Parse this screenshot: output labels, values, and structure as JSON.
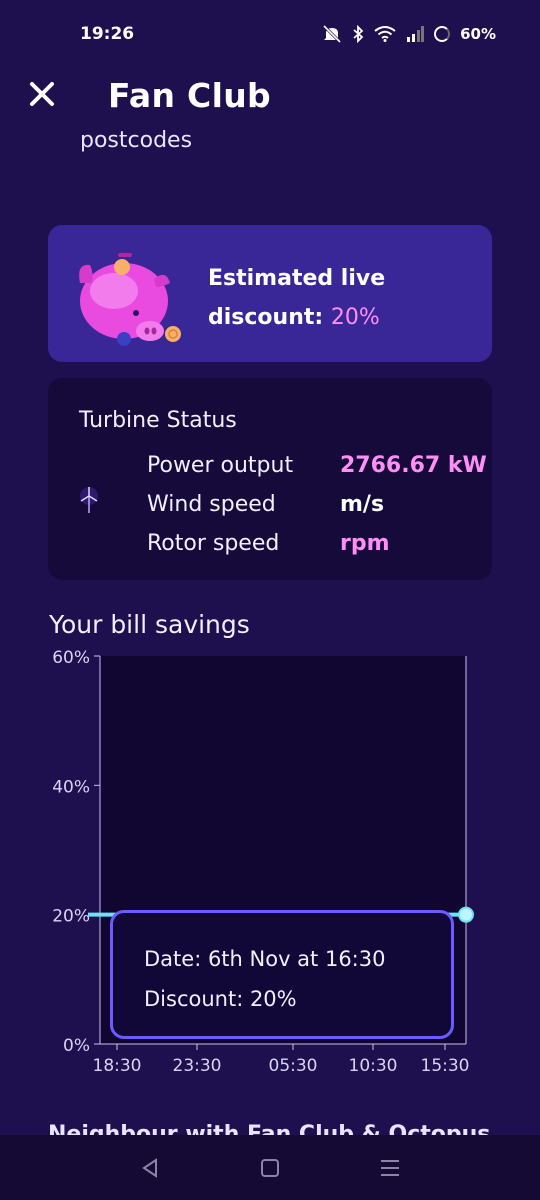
{
  "status_bar": {
    "time": "19:26",
    "battery_percent": "60%"
  },
  "header": {
    "title": "Fan Club",
    "close_icon": "close-icon"
  },
  "partial_text": "postcodes",
  "discount_card": {
    "label_line1": "Estimated live",
    "label_line2": "discount:",
    "value": "20%"
  },
  "turbine": {
    "title": "Turbine Status",
    "rows": [
      {
        "label": "Power output",
        "value": "2766.67 kW"
      },
      {
        "label": "Wind speed",
        "value": "m/s"
      },
      {
        "label": "Rotor speed",
        "value": "rpm"
      }
    ]
  },
  "savings": {
    "title": "Your bill savings",
    "tooltip": {
      "date_line": "Date: 6th Nov at 16:30",
      "discount_line": "Discount: 20%"
    }
  },
  "chart_data": {
    "type": "line",
    "x": [
      "18:30",
      "23:30",
      "05:30",
      "10:30",
      "15:30",
      "16:30"
    ],
    "x_ticks": [
      "18:30",
      "23:30",
      "05:30",
      "10:30",
      "15:30"
    ],
    "y_ticks": [
      "60%",
      "40%",
      "20%",
      "0%"
    ],
    "ylim": [
      0,
      60
    ],
    "series": [
      {
        "values": [
          20,
          20,
          20,
          20,
          20,
          20
        ]
      }
    ],
    "colors": {
      "line": "#6fe0f5",
      "plot_bg": "#110631",
      "axis": "#c9c3e8"
    }
  },
  "bottom_partial": "Neighbour with Fan Club & Octopus",
  "colors": {
    "background": "#1e0f4f",
    "card_purple": "#3a2797",
    "card_dark": "#160a3a",
    "accent_pink": "#ff8ef5",
    "tooltip_border": "#6c5cff"
  }
}
